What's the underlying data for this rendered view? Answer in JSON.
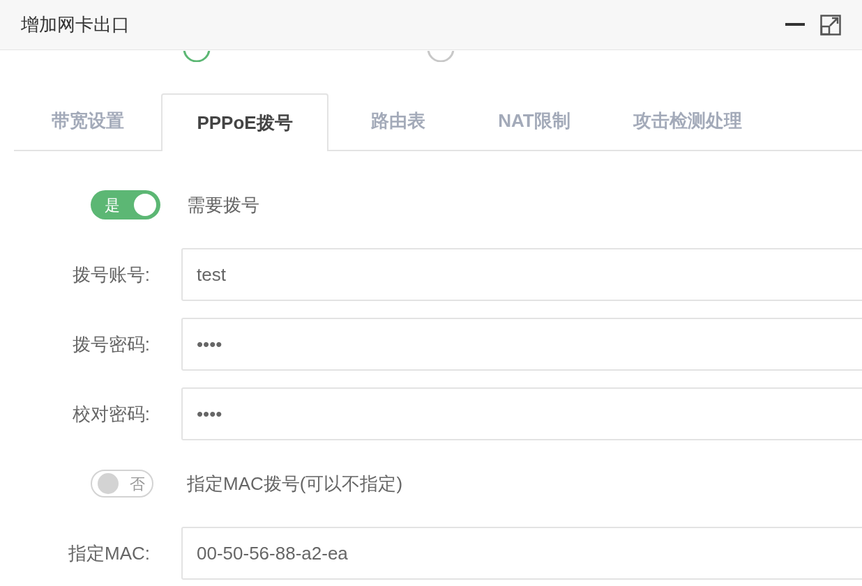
{
  "window": {
    "title": "增加网卡出口"
  },
  "work_mode_radios": [
    {
      "selected": true
    },
    {
      "selected": false
    }
  ],
  "tabs": [
    {
      "label": "带宽设置",
      "selected": false
    },
    {
      "label": "PPPoE拨号",
      "selected": true
    },
    {
      "label": "路由表",
      "selected": false
    },
    {
      "label": "NAT限制",
      "selected": false
    },
    {
      "label": "攻击检测处理",
      "selected": false
    }
  ],
  "form": [
    {
      "kind": "toggle",
      "on": true,
      "switch_text": "是",
      "label": "需要拨号"
    },
    {
      "kind": "field",
      "label": "拨号账号:",
      "value": "test"
    },
    {
      "kind": "field",
      "label": "拨号密码:",
      "value": "••••"
    },
    {
      "kind": "field",
      "label": "校对密码:",
      "value": "••••"
    },
    {
      "kind": "toggle",
      "on": false,
      "switch_text": "否",
      "label": "指定MAC拨号(可以不指定)"
    },
    {
      "kind": "field",
      "label": "指定MAC:",
      "value": "00-50-56-88-a2-ea"
    }
  ]
}
